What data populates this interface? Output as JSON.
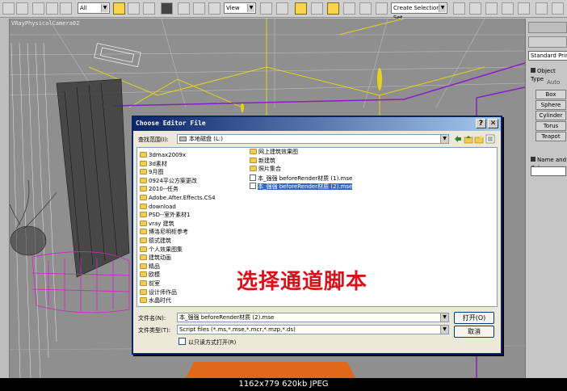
{
  "toolbar": {
    "filter_value": "All",
    "view_value": "View",
    "selection_set_placeholder": "Create Selection Set"
  },
  "viewport": {
    "label": "VRayPhysicalCamera02"
  },
  "command_panel": {
    "category_dropdown": "Standard Primitives",
    "object_type_header": "Object Type",
    "autogrid_label": "Auto",
    "buttons": [
      "Box",
      "Sphere",
      "Cylinder",
      "Torus",
      "Teapot"
    ],
    "name_color_header": "Name and Color"
  },
  "dialog": {
    "title": "Choose Editor File",
    "look_in_label": "查找范围(I):",
    "look_in_value": "本地磁盘 (L:)",
    "items_col1": [
      "3dmax2009x",
      "3d素材",
      "9月图",
      "0924平公方案更改",
      "2010--任务",
      "Adobe.After.Effects.CS4",
      "download",
      "PSD--室外素材1",
      "vray 建筑",
      "博洛尼明柜参考",
      "德式建筑",
      "个人效果图集",
      "建筑动画",
      "精品",
      "欧模",
      "前室",
      "设计师作品",
      "水晶时代"
    ],
    "items_col2": [
      {
        "name": "网上建筑效果图",
        "kind": "folder"
      },
      {
        "name": "新建筑",
        "kind": "folder"
      },
      {
        "name": "照片集合",
        "kind": "folder"
      },
      {
        "name": "本_强强  beforeRender材质 (1).mse",
        "kind": "file"
      },
      {
        "name": "本_强强  beforeRender材质 (2).mse",
        "kind": "file",
        "selected": true
      }
    ],
    "overlay_annotation": "选择通道脚本",
    "filename_label": "文件名(N):",
    "filename_value": "本_强强  beforeRender材质 (2).mse",
    "filetype_label": "文件类型(T):",
    "filetype_value": "Script files (*.ms,*.mse,*.mcr,*.mzp,*.ds)",
    "open_button": "打开(O)",
    "cancel_button": "取消",
    "readonly_label": "以只读方式打开(R)"
  },
  "caption": "1162x779  620kb  JPEG"
}
